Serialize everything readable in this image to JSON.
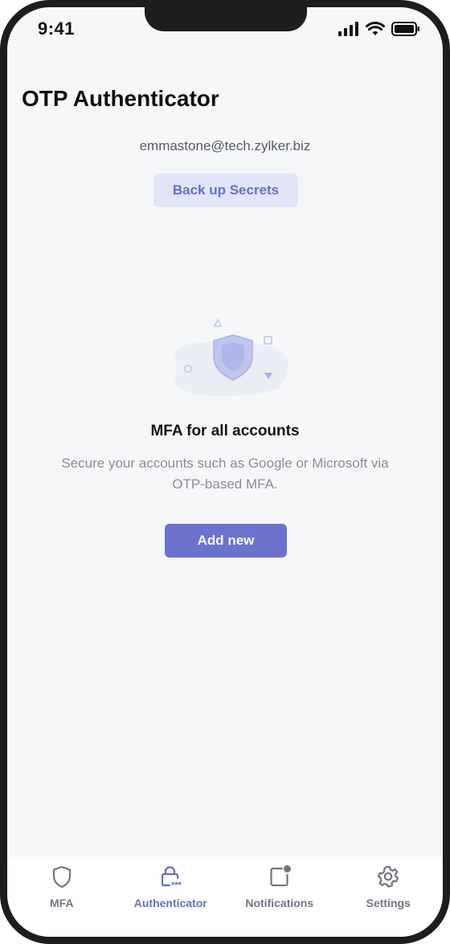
{
  "status_bar": {
    "time": "9:41"
  },
  "header": {
    "title": "OTP Authenticator"
  },
  "account": {
    "email": "emmastone@tech.zylker.biz"
  },
  "backup_button": {
    "label": "Back up Secrets"
  },
  "empty_state": {
    "illustration_icon": "shield-icon",
    "heading": "MFA for all accounts",
    "description": "Secure your accounts such as Google or Microsoft via OTP-based MFA.",
    "add_button_label": "Add new"
  },
  "tabbar": {
    "active": "Authenticator",
    "tabs": [
      {
        "label": "MFA",
        "icon": "shield-icon"
      },
      {
        "label": "Authenticator",
        "icon": "lock-icon"
      },
      {
        "label": "Notifications",
        "icon": "notification-icon"
      },
      {
        "label": "Settings",
        "icon": "gear-icon"
      }
    ]
  },
  "colors": {
    "accent": "#6b72cc",
    "accent_light": "#e3e6f9",
    "background": "#f6f7f9",
    "text_primary": "#111111",
    "text_secondary": "#8a8d94"
  }
}
